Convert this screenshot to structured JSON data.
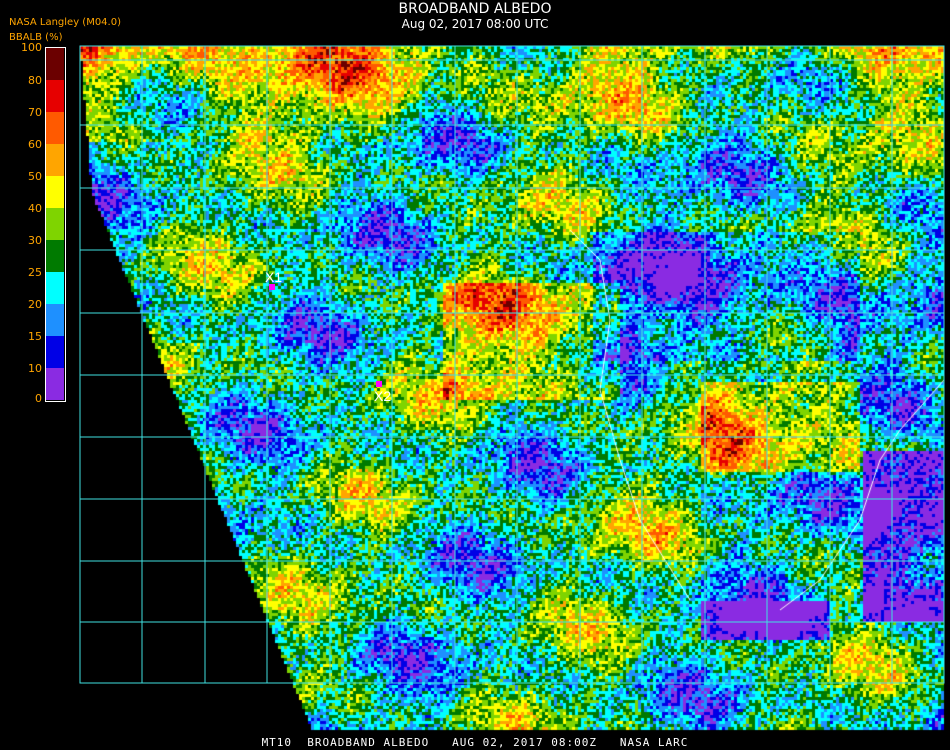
{
  "header": {
    "title": "BROADBAND ALBEDO",
    "subtitle": "Aug 02, 2017 08:00 UTC",
    "source": "NASA Langley (M04.0)",
    "units_label": "BBALB (%)"
  },
  "colorbar": {
    "tick_labels": [
      "100",
      "80",
      "70",
      "60",
      "50",
      "40",
      "30",
      "25",
      "20",
      "15",
      "10",
      "0"
    ],
    "bins": [
      {
        "from": 80,
        "to": 100,
        "color": "#6b0000"
      },
      {
        "from": 70,
        "to": 80,
        "color": "#e60000"
      },
      {
        "from": 60,
        "to": 70,
        "color": "#ff5a00"
      },
      {
        "from": 50,
        "to": 60,
        "color": "#ffa500"
      },
      {
        "from": 40,
        "to": 50,
        "color": "#ffff00"
      },
      {
        "from": 30,
        "to": 40,
        "color": "#7fd400"
      },
      {
        "from": 25,
        "to": 30,
        "color": "#007a00"
      },
      {
        "from": 20,
        "to": 25,
        "color": "#00ffff"
      },
      {
        "from": 15,
        "to": 20,
        "color": "#1e90ff"
      },
      {
        "from": 10,
        "to": 15,
        "color": "#0000e6"
      },
      {
        "from": 0,
        "to": 10,
        "color": "#8a2be2"
      }
    ]
  },
  "map": {
    "grid_color": "#40e0e0",
    "markers": [
      {
        "label": "X1",
        "color": "#ff00ff"
      },
      {
        "label": "X2",
        "color": "#ff00ff"
      }
    ]
  },
  "footer": "MT10  BROADBAND ALBEDO   AUG 02, 2017 08:00Z   NASA LARC"
}
